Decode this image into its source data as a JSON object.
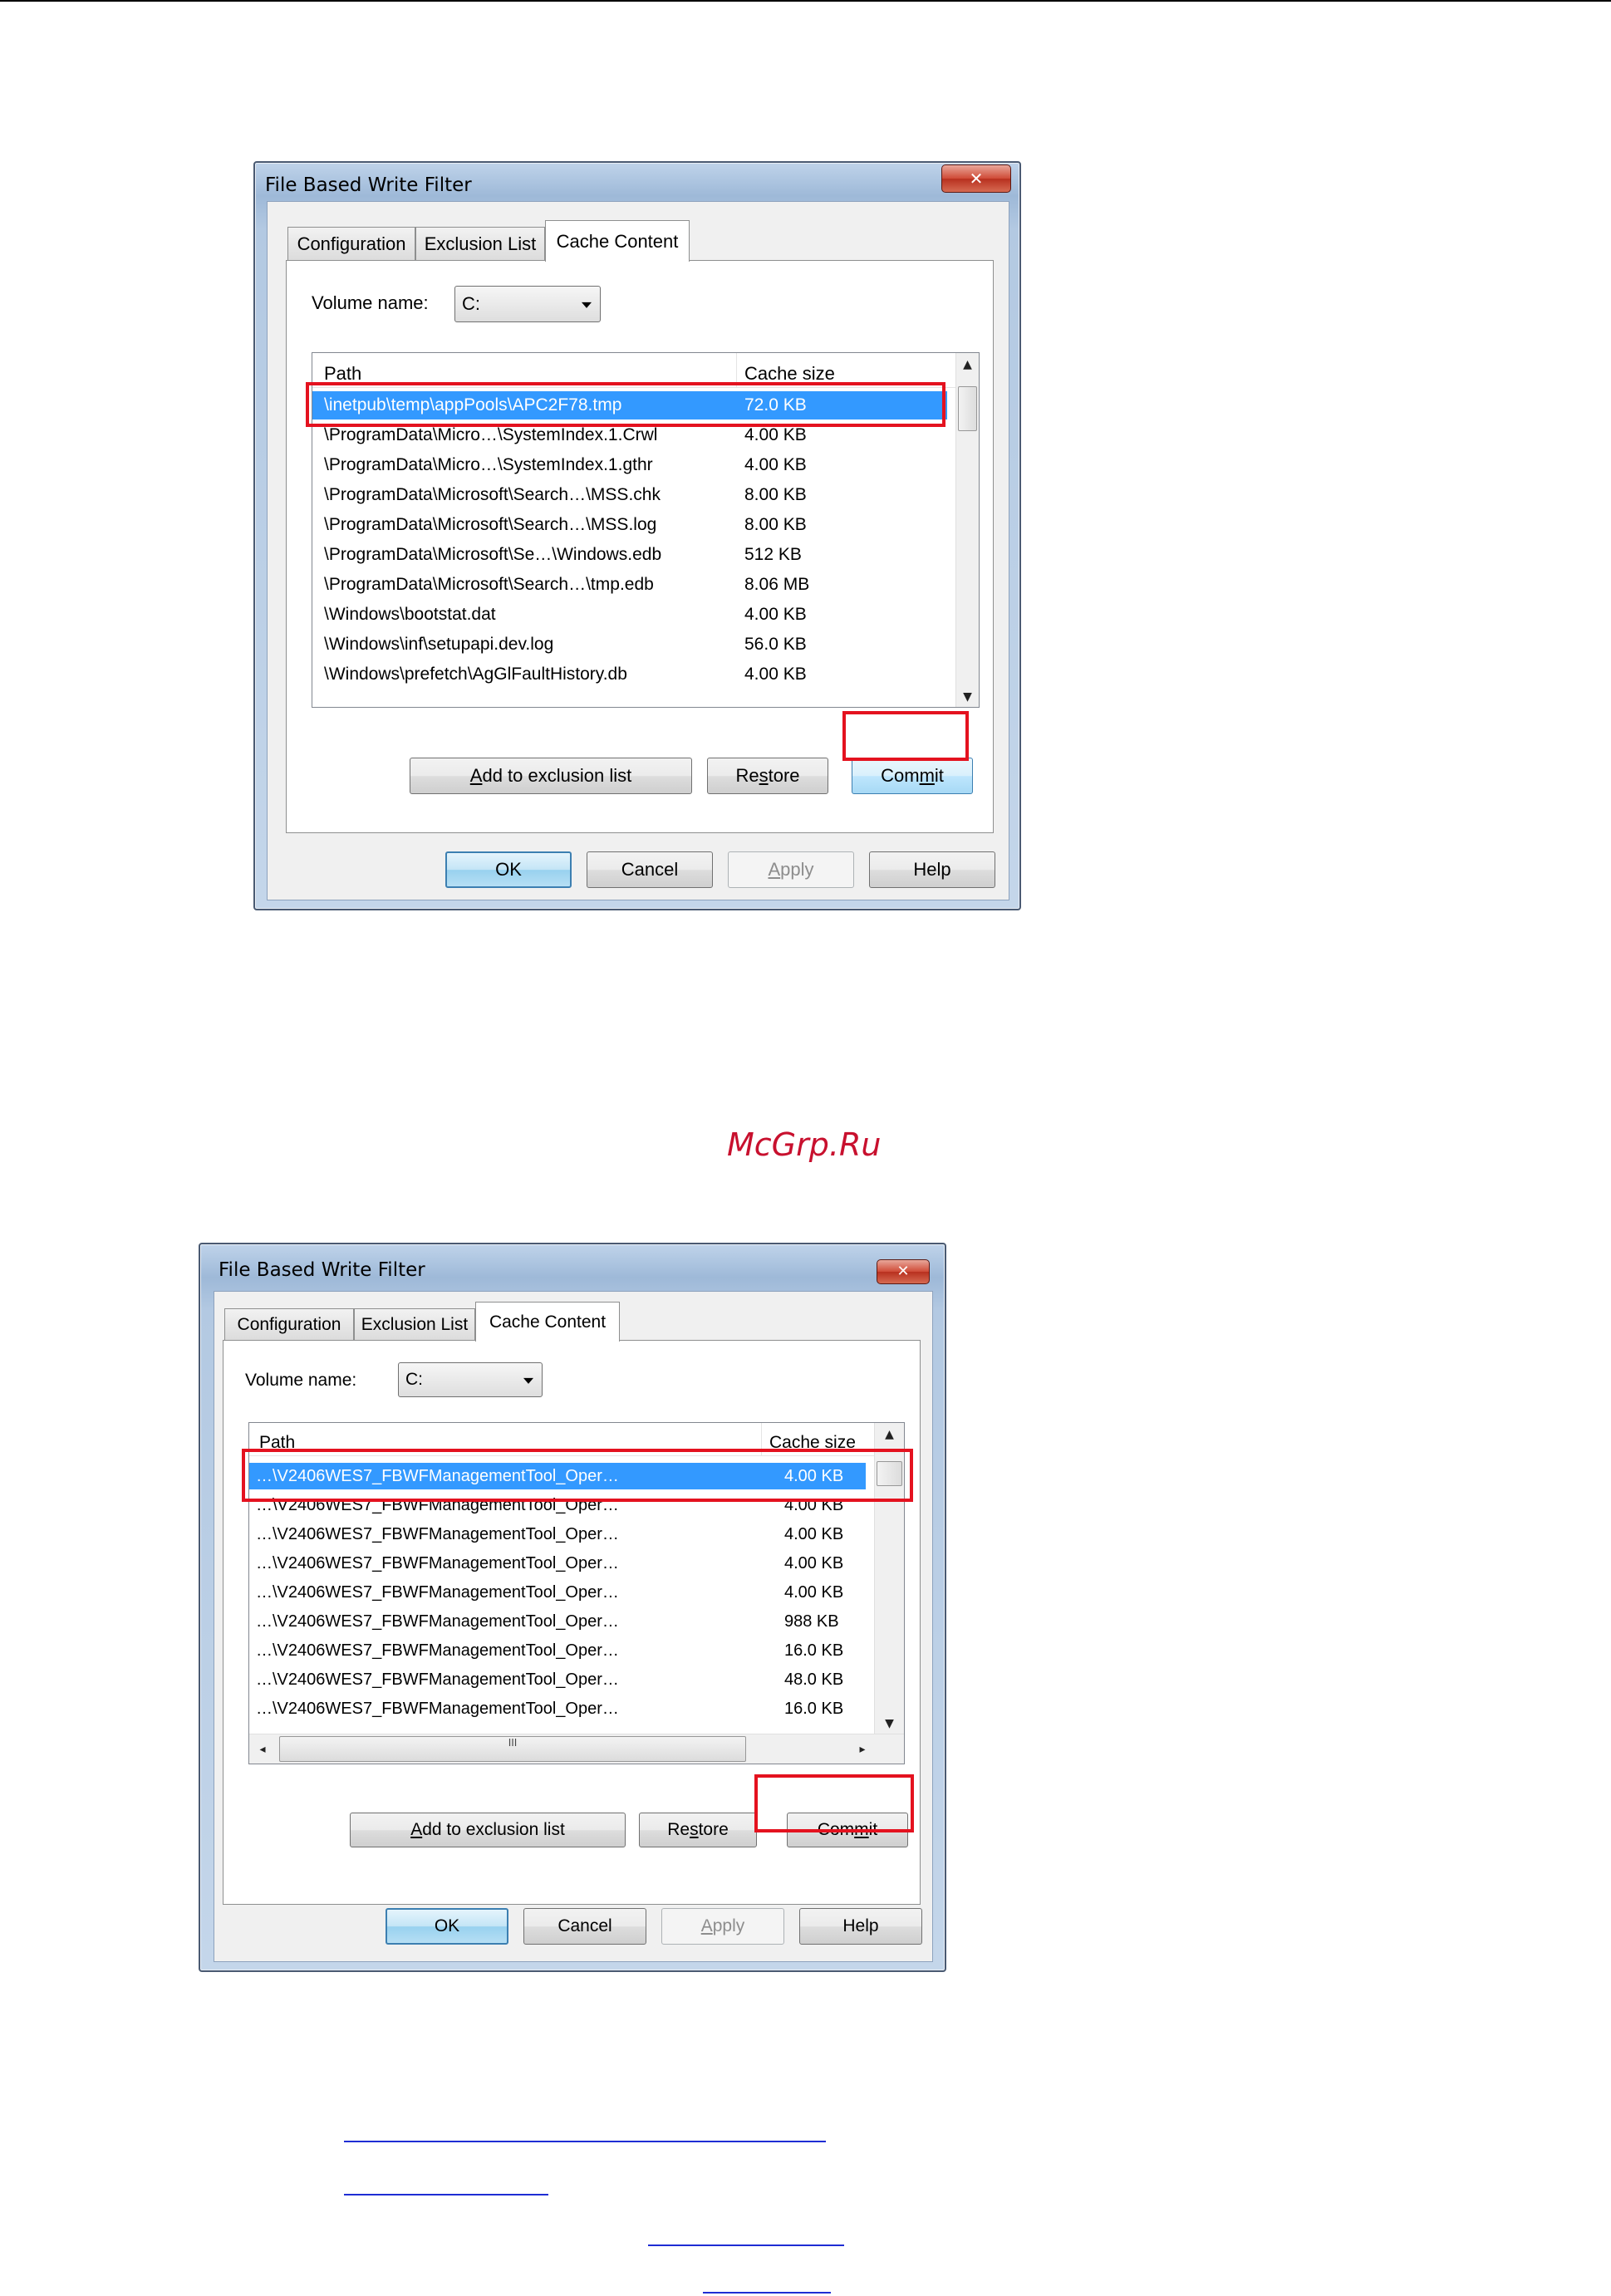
{
  "watermark": "McGrp.Ru",
  "dialogs": [
    {
      "title": "File Based Write Filter",
      "close_glyph": "✕",
      "tabs": [
        "Configuration",
        "Exclusion List",
        "Cache Content"
      ],
      "active_tab": "Cache Content",
      "volume_label": "Volume name:",
      "volume_value": "C:",
      "columns": [
        "Path",
        "Cache size"
      ],
      "rows": [
        {
          "path": "\\inetpub\\temp\\appPools\\APC2F78.tmp",
          "size": "72.0 KB",
          "selected": true
        },
        {
          "path": "\\ProgramData\\Micro…\\SystemIndex.1.Crwl",
          "size": "4.00 KB"
        },
        {
          "path": "\\ProgramData\\Micro…\\SystemIndex.1.gthr",
          "size": "4.00 KB"
        },
        {
          "path": "\\ProgramData\\Microsoft\\Search…\\MSS.chk",
          "size": "8.00 KB"
        },
        {
          "path": "\\ProgramData\\Microsoft\\Search…\\MSS.log",
          "size": "8.00 KB"
        },
        {
          "path": "\\ProgramData\\Microsoft\\Se…\\Windows.edb",
          "size": "512 KB"
        },
        {
          "path": "\\ProgramData\\Microsoft\\Search…\\tmp.edb",
          "size": "8.06 MB"
        },
        {
          "path": "\\Windows\\bootstat.dat",
          "size": "4.00 KB"
        },
        {
          "path": "\\Windows\\inf\\setupapi.dev.log",
          "size": "56.0 KB"
        },
        {
          "path": "\\Windows\\prefetch\\AgGlFaultHistory.db",
          "size": "4.00 KB"
        }
      ],
      "buttons": {
        "add": {
          "pre": "",
          "key": "A",
          "post": "dd to exclusion list"
        },
        "restore": {
          "pre": "Re",
          "key": "s",
          "post": "tore"
        },
        "commit": {
          "pre": "Com",
          "key": "m",
          "post": "it"
        },
        "ok": "OK",
        "cancel": "Cancel",
        "apply": {
          "pre": "",
          "key": "A",
          "post": "pply"
        },
        "help": "Help"
      }
    },
    {
      "title": "File Based Write Filter",
      "close_glyph": "✕",
      "tabs": [
        "Configuration",
        "Exclusion List",
        "Cache Content"
      ],
      "active_tab": "Cache Content",
      "volume_label": "Volume name:",
      "volume_value": "C:",
      "columns": [
        "Path",
        "Cache size"
      ],
      "rows": [
        {
          "path": "…\\V2406WES7_FBWFManagementTool_Oper…",
          "size": "4.00 KB",
          "selected": true
        },
        {
          "path": "…\\V2406WES7_FBWFManagementTool_Oper…",
          "size": "4.00 KB"
        },
        {
          "path": "…\\V2406WES7_FBWFManagementTool_Oper…",
          "size": "4.00 KB"
        },
        {
          "path": "…\\V2406WES7_FBWFManagementTool_Oper…",
          "size": "4.00 KB"
        },
        {
          "path": "…\\V2406WES7_FBWFManagementTool_Oper…",
          "size": "4.00 KB"
        },
        {
          "path": "…\\V2406WES7_FBWFManagementTool_Oper…",
          "size": "988 KB"
        },
        {
          "path": "…\\V2406WES7_FBWFManagementTool_Oper…",
          "size": "16.0 KB"
        },
        {
          "path": "…\\V2406WES7_FBWFManagementTool_Oper…",
          "size": "48.0 KB"
        },
        {
          "path": "…\\V2406WES7_FBWFManagementTool_Oper…",
          "size": "16.0 KB"
        }
      ],
      "hscroll_grip": "III",
      "buttons": {
        "add": {
          "pre": "",
          "key": "A",
          "post": "dd to exclusion list"
        },
        "restore": {
          "pre": "Re",
          "key": "s",
          "post": "tore"
        },
        "commit": {
          "pre": "Com",
          "key": "m",
          "post": "it"
        },
        "ok": "OK",
        "cancel": "Cancel",
        "apply": {
          "pre": "",
          "key": "A",
          "post": "pply"
        },
        "help": "Help"
      }
    }
  ],
  "colors": {
    "highlight": "#e4121f",
    "selection": "#3399ff",
    "link": "#1f2dd4",
    "watermark": "#c8102e"
  }
}
